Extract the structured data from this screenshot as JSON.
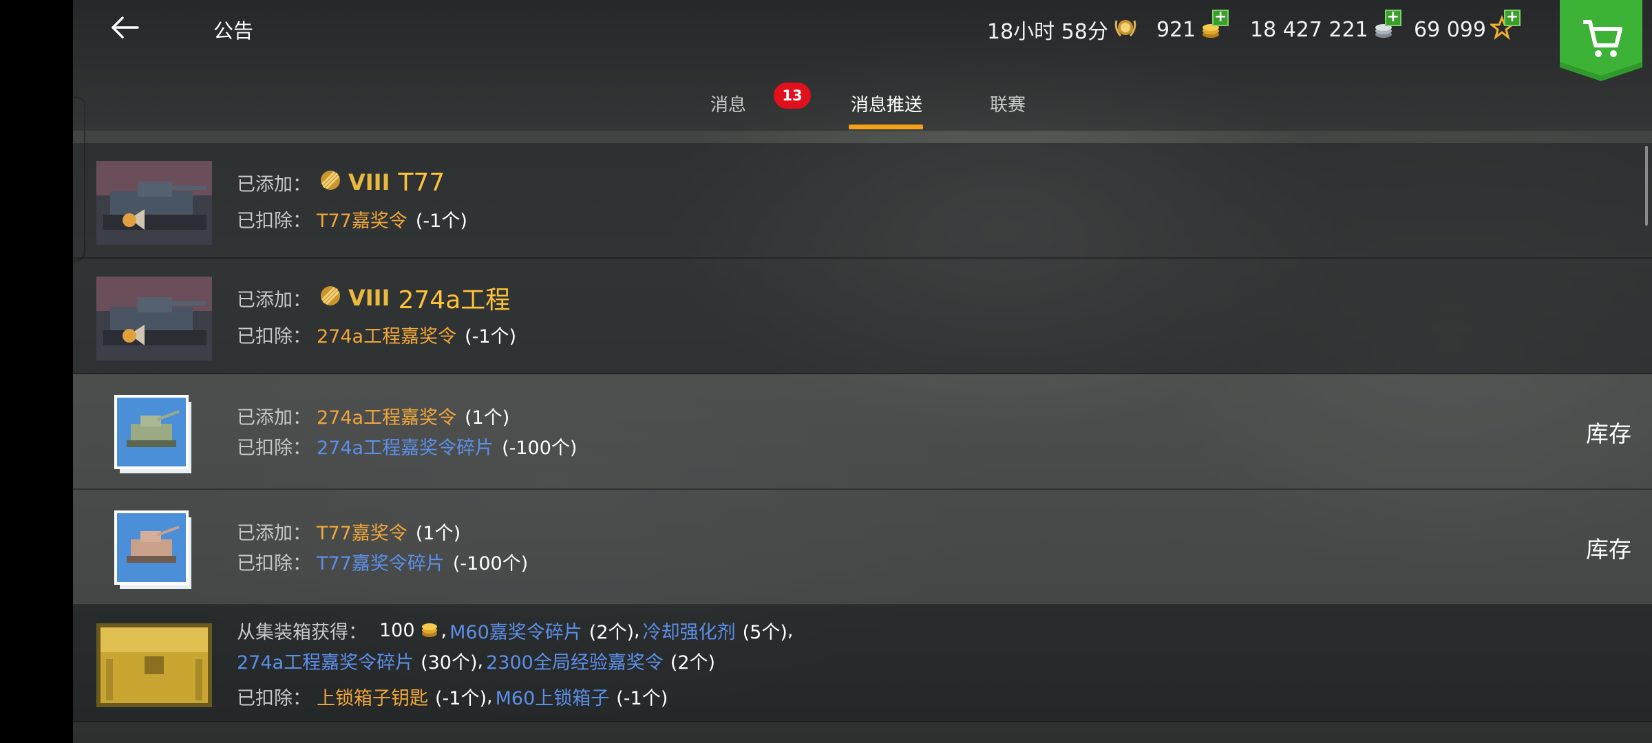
{
  "header": {
    "title": "公告",
    "timer": "18小时 58分",
    "gold": "921",
    "credits": "18 427 221",
    "free_xp": "69 099"
  },
  "tabs": [
    {
      "label": "消息"
    },
    {
      "label": "消息推送"
    },
    {
      "label": "联赛"
    }
  ],
  "badge": "13",
  "labels": {
    "added": "已添加：",
    "deducted": "已扣除：",
    "from_box": "从集装箱获得：",
    "inventory": "库存"
  },
  "rows": [
    {
      "tier": "VIII",
      "tank": "T77",
      "deducted_item": "T77嘉奖令",
      "deducted_qty": "(-1个)"
    },
    {
      "tier": "VIII",
      "tank": "274a工程",
      "deducted_item": "274a工程嘉奖令",
      "deducted_qty": "(-1个)"
    },
    {
      "added_item": "274a工程嘉奖令",
      "added_qty": "(1个)",
      "deducted_item": "274a工程嘉奖令碎片",
      "deducted_qty": "(-100个)"
    },
    {
      "added_item": "T77嘉奖令",
      "added_qty": "(1个)",
      "deducted_item": "T77嘉奖令碎片",
      "deducted_qty": "(-100个)"
    },
    {
      "gold_amount": "100",
      "item1": "M60嘉奖令碎片",
      "item1_qty": "(2个)",
      "item2": "冷却强化剂",
      "item2_qty": "(5个)",
      "item3": "274a工程嘉奖令碎片",
      "item3_qty": "(30个)",
      "item4": "2300全局经验嘉奖令",
      "item4_qty": "(2个)",
      "deducted1": "上锁箱子钥匙",
      "deducted1_qty": "(-1个)",
      "deducted2": "M60上锁箱子",
      "deducted2_qty": "(-1个)"
    }
  ],
  "colors": {
    "accent": "#f5a21a",
    "gold_text": "#f0a63a",
    "blue_text": "#5c8fe8",
    "badge": "#e0101c",
    "shop": "#2f9a2b"
  },
  "icons": {
    "back": "arrow-left-icon",
    "timer": "laurel-medal-icon",
    "gold": "gold-coins-icon",
    "credits": "silver-coins-icon",
    "free_xp": "star-icon",
    "shop": "cart-icon"
  }
}
